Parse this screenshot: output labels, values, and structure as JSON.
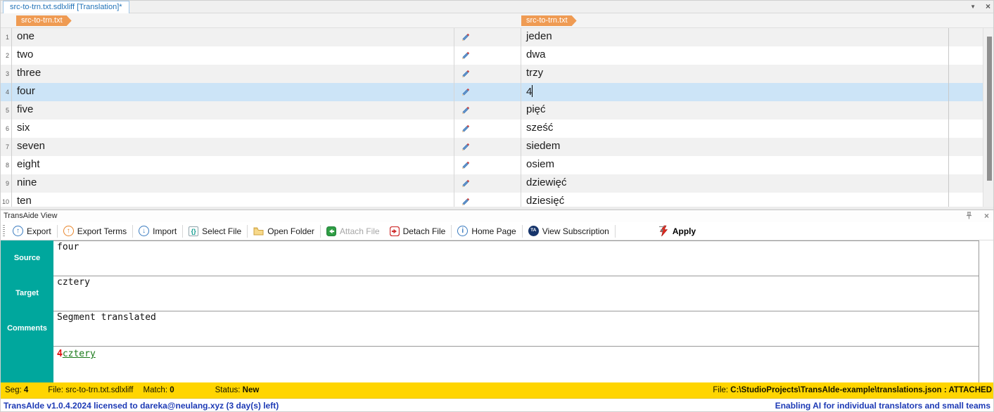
{
  "tab": {
    "title": "src-to-trn.txt.sdlxliff [Translation]*"
  },
  "editor": {
    "source_badge": "src-to-trn.txt",
    "target_badge": "src-to-trn.txt",
    "rows": [
      {
        "num": "1",
        "source": "one",
        "target": "jeden",
        "selected": false
      },
      {
        "num": "2",
        "source": "two",
        "target": "dwa",
        "selected": false
      },
      {
        "num": "3",
        "source": "three",
        "target": "trzy",
        "selected": false
      },
      {
        "num": "4",
        "source": "four",
        "target": "4",
        "selected": true
      },
      {
        "num": "5",
        "source": "five",
        "target": "pięć",
        "selected": false
      },
      {
        "num": "6",
        "source": "six",
        "target": "sześć",
        "selected": false
      },
      {
        "num": "7",
        "source": "seven",
        "target": "siedem",
        "selected": false
      },
      {
        "num": "8",
        "source": "eight",
        "target": "osiem",
        "selected": false
      },
      {
        "num": "9",
        "source": "nine",
        "target": "dziewięć",
        "selected": false
      },
      {
        "num": "10",
        "source": "ten",
        "target": "dziesięć",
        "selected": false
      }
    ]
  },
  "panel": {
    "title": "TransAide View",
    "toolbar": {
      "buttons": [
        {
          "label": "Export",
          "icon": "export-up-arrow-icon",
          "disabled": false
        },
        {
          "label": "Export Terms",
          "icon": "export-terms-up-arrow-icon",
          "disabled": false
        },
        {
          "label": "Import",
          "icon": "import-down-arrow-icon",
          "disabled": false
        },
        {
          "label": "Select File",
          "icon": "select-file-braces-icon",
          "disabled": false
        },
        {
          "label": "Open Folder",
          "icon": "folder-icon",
          "disabled": false
        },
        {
          "label": "Attach File",
          "icon": "attach-file-icon",
          "disabled": true
        },
        {
          "label": "Detach File",
          "icon": "detach-file-icon",
          "disabled": false
        },
        {
          "label": "Home Page",
          "icon": "info-circle-icon",
          "disabled": false
        },
        {
          "label": "View Subscription",
          "icon": "transaide-logo-icon",
          "disabled": false
        }
      ],
      "apply_label": "Apply"
    },
    "fields": {
      "source_label": "Source",
      "source_value": "four",
      "target_label": "Target",
      "target_value": "cztery",
      "comments_label": "Comments",
      "comments_value": "Segment translated",
      "diff_removed": "4",
      "diff_added": "cztery"
    }
  },
  "status_bar": {
    "seg_label": "Seg:",
    "seg_value": "4",
    "file_label": "File:",
    "file_value": "src-to-trn.txt.sdlxliff",
    "match_label": "Match:",
    "match_value": "0",
    "status_label": "Status:",
    "status_value": "New",
    "right_file_label": "File:",
    "right_file_path": "C:\\StudioProjects\\TransAIde-example\\translations.json",
    "right_file_state": ": ATTACHED"
  },
  "footer": {
    "left": "TransAIde v1.0.4.2024 licensed to dareka@neulang.xyz (3 day(s) left)",
    "right": "Enabling AI for individual translators and small teams"
  },
  "colors": {
    "accent_teal": "#00A79D",
    "badge_orange": "#EF9B53",
    "row_highlight_blue": "#CCE4F7",
    "status_yellow": "#FFD500",
    "footer_blue": "#1D3AB5",
    "tab_text_blue": "#2273B8",
    "diff_removed_red": "#E01B1B",
    "diff_added_green": "#1A7A1A"
  }
}
